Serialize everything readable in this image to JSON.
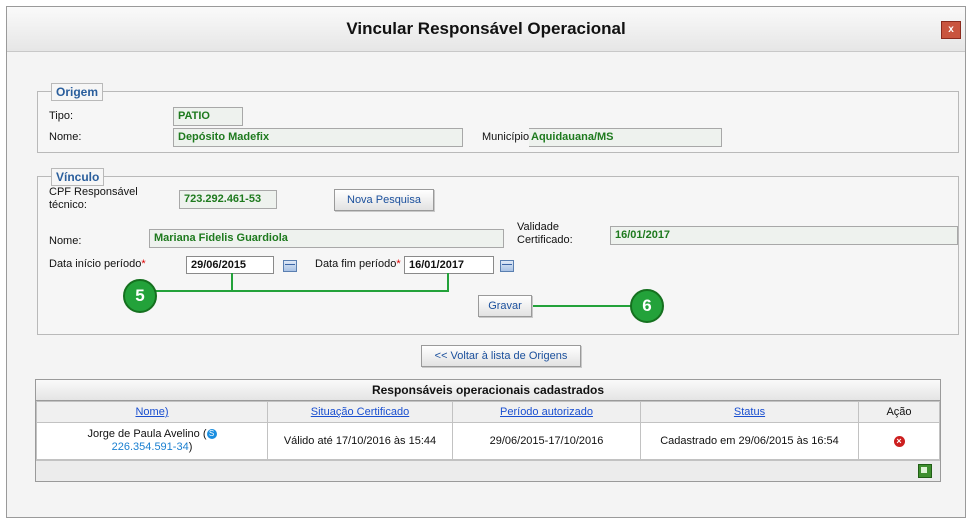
{
  "window": {
    "title": "Vincular Responsável Operacional",
    "close_glyph": "x"
  },
  "origem": {
    "legend": "Origem",
    "tipo_label": "Tipo:",
    "tipo_value": "PATIO",
    "nome_label": "Nome:",
    "nome_value": "Depósito Madefix",
    "municipio_label": "Município:",
    "municipio_value": "Aquidauana/MS"
  },
  "vinculo": {
    "legend": "Vínculo",
    "cpf_label": "CPF Responsável técnico:",
    "cpf_value": "723.292.461-53",
    "nova_pesquisa_label": "Nova Pesquisa",
    "nome_label": "Nome:",
    "nome_value": "Mariana Fidelis Guardiola",
    "validade_label": "Validade Certificado:",
    "validade_value": "16/01/2017",
    "data_inicio_label": "Data início período",
    "data_inicio_value": "29/06/2015",
    "data_fim_label": "Data fim período",
    "data_fim_value": "16/01/2017",
    "required_mark": "*",
    "gravar_label": "Gravar"
  },
  "markers": {
    "m5": "5",
    "m6": "6"
  },
  "voltar_label": "<< Voltar à lista de Origens",
  "table": {
    "caption": "Responsáveis operacionais cadastrados",
    "headers": [
      "Nome)",
      "Situação Certificado",
      "Período autorizado",
      "Status",
      "Ação"
    ],
    "rows": [
      {
        "nome": "Jorge de Paula Avelino (",
        "cpf": "226.354.591-34",
        "cpf_suffix": ")",
        "situacao": "Válido até 17/10/2016 às 15:44",
        "periodo": "29/06/2015-17/10/2016",
        "status": "Cadastrado em 29/06/2015 às 16:54"
      }
    ]
  },
  "icons": [
    "close-icon",
    "calendar-icon",
    "skype-icon",
    "delete-icon",
    "excel-export-icon"
  ],
  "colors": {
    "value_text": "#1e7a1e",
    "legend_text": "#2a5e9c",
    "link": "#1a7fd0",
    "marker": "#23a23a",
    "delete": "#cc1f1f"
  }
}
